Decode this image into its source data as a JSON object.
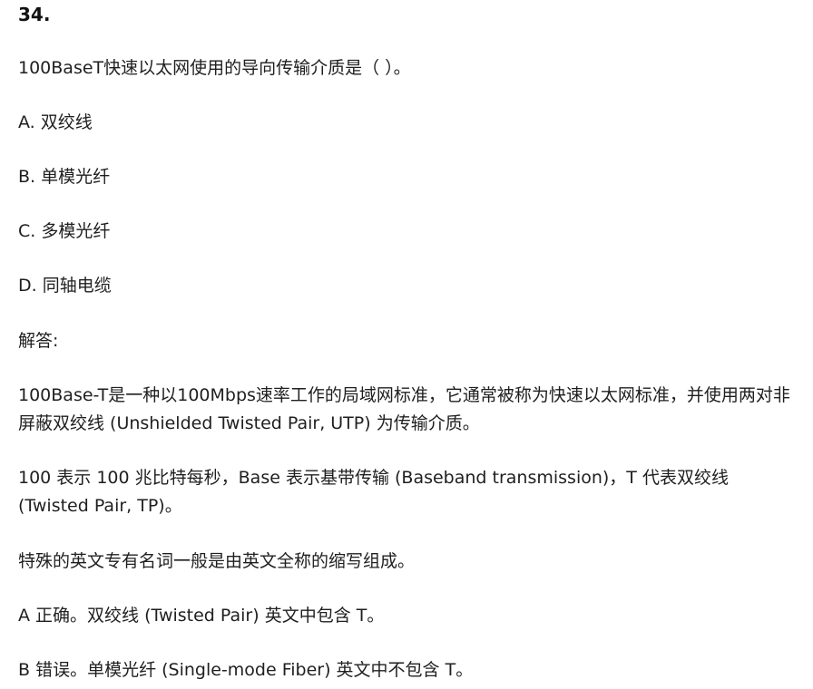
{
  "question": {
    "number": "34.",
    "stem": "100BaseT快速以太网使用的导向传输介质是（ ）。",
    "options": [
      "A. 双绞线",
      "B. 单模光纤",
      "C. 多模光纤",
      "D. 同轴电缆"
    ]
  },
  "answer": {
    "heading": "解答:",
    "paragraphs": [
      "100Base-T是一种以100Mbps速率工作的局域网标准，它通常被称为快速以太网标准，并使用两对非屏蔽双绞线 (Unshielded Twisted Pair, UTP) 为传输介质。",
      "100 表示 100 兆比特每秒，Base 表示基带传输 (Baseband transmission)，T 代表双绞线 (Twisted Pair, TP)。",
      "特殊的英文专有名词一般是由英文全称的缩写组成。",
      "A 正确。双绞线 (Twisted Pair) 英文中包含 T。",
      "B 错误。单模光纤 (Single-mode Fiber) 英文中不包含 T。"
    ]
  }
}
